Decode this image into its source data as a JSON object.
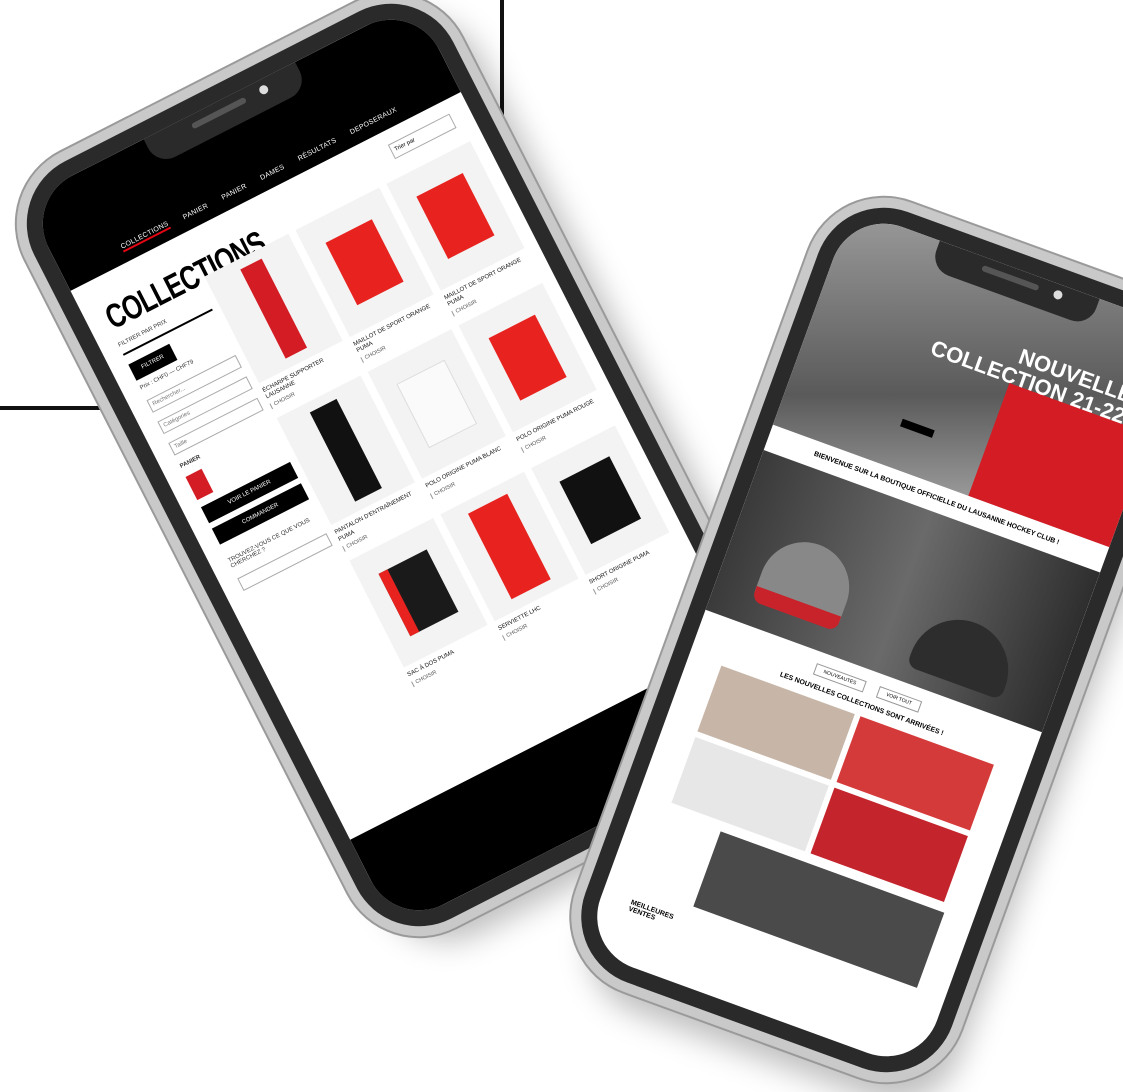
{
  "left_phone": {
    "nav": [
      "COLLECTIONS",
      "PANIER",
      "PANIER",
      "DAMES",
      "RÉSULTATS",
      "DEPOSERAUX"
    ],
    "page_title": "COLLECTIONS",
    "sort_label": "Trier par",
    "filter_label": "FILTRER PAR PRIX",
    "filter_button": "FILTRER",
    "price_range": "Prix : CHF0 — CHF79",
    "search_placeholder": "Rechercher...",
    "field_2": "Catégories",
    "field_3": "Taille",
    "panier_label": "PANIER",
    "buttons": [
      "VOIR LE PANIER",
      "COMMANDER"
    ],
    "promo_label": "TROUVEZ-VOUS CE QUE VOUS CHERCHEZ ?",
    "products": [
      {
        "name": "ÉCHARPE SUPPORTER LAUSANNE",
        "price": "CHOISIR"
      },
      {
        "name": "MAILLOT DE SPORT ORANGE PUMA",
        "price": "CHOISIR"
      },
      {
        "name": "MAILLOT DE SPORT ORANGE PUMA",
        "price": "CHOISIR"
      },
      {
        "name": "PANTALON D'ENTRAÎNEMENT PUMA",
        "price": "CHOISIR"
      },
      {
        "name": "POLO ORIGINE PUMA BLANC",
        "price": "CHOISIR"
      },
      {
        "name": "POLO ORIGINE PUMA ROUGE",
        "price": "CHOISIR"
      },
      {
        "name": "SAC À DOS PUMA",
        "price": "CHOISIR"
      },
      {
        "name": "SERVIETTE LHC",
        "price": "CHOISIR"
      },
      {
        "name": "SHORT ORIGINE PUMA",
        "price": "CHOISIR"
      }
    ],
    "colors": {
      "accent": "#e30613",
      "black": "#000000"
    }
  },
  "right_phone": {
    "hero_text": [
      "NOUVELLE",
      "COLLECTION 21-22"
    ],
    "welcome": "BIENVENUE SUR LA BOUTIQUE OFFICIELLE DU LAUSANNE HOCKEY CLUB !",
    "tabs": [
      "NOUVEAUTÉS",
      "VOIR TOUT"
    ],
    "new_collections": "LES NOUVELLES COLLECTIONS SONT ARRIVÉES !",
    "best_sellers": [
      "MEILLEURES",
      "VENTES"
    ]
  }
}
